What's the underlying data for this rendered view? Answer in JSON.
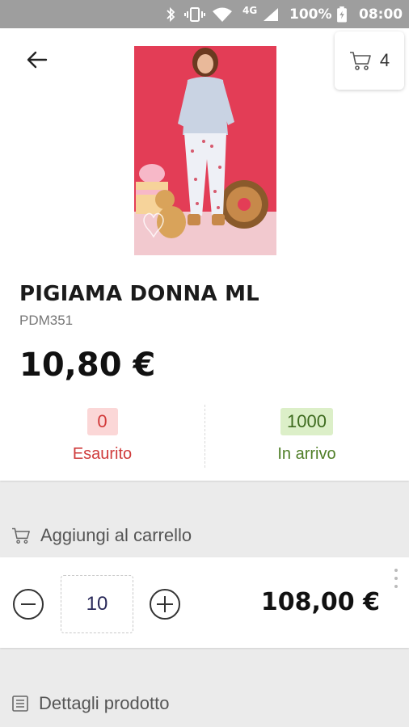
{
  "status_bar": {
    "network": "4G",
    "battery": "100%",
    "time": "08:00",
    "icons": [
      "bluetooth-icon",
      "vibrate-icon",
      "wifi-icon",
      "signal-icon",
      "battery-icon"
    ]
  },
  "header": {
    "back_icon": "arrow-left-icon",
    "cart_icon": "cart-icon",
    "cart_count": "4"
  },
  "product": {
    "image_alt": "product-photo",
    "name": "PIGIAMA DONNA ML",
    "code": "PDM351",
    "price": "10,80 €",
    "stock": {
      "available_qty": "0",
      "available_label": "Esaurito",
      "incoming_qty": "1000",
      "incoming_label": "In arrivo"
    }
  },
  "add_to_cart": {
    "section_label": "Aggiungi al carrello",
    "quantity": "10",
    "line_total": "108,00 €"
  },
  "details": {
    "section_label": "Dettagli prodotto"
  },
  "colors": {
    "status_bar": "#9e9e9e",
    "out_of_stock": "#d23a3a",
    "incoming": "#4f7e27",
    "photo_bg": "#e33d56"
  }
}
